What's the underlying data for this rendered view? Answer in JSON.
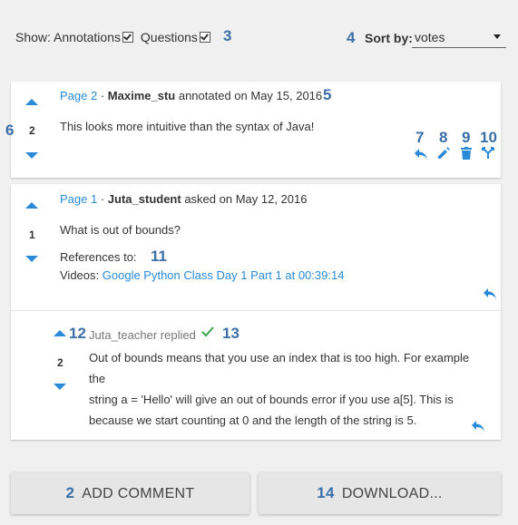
{
  "toolbar": {
    "show_label": "Show:",
    "annotations_label": "Annotations",
    "questions_label": "Questions",
    "sort_by_label": "Sort by:",
    "sort_value": "votes"
  },
  "annotations_markers": {
    "n2": "2",
    "n3": "3",
    "n4": "4",
    "n5": "5",
    "n6": "6",
    "n7": "7",
    "n8": "8",
    "n9": "9",
    "n10": "10",
    "n11": "11",
    "n12": "12",
    "n13": "13",
    "n14": "14"
  },
  "posts": [
    {
      "votes": "2",
      "page": "Page 2",
      "sep": "·",
      "author": "Maxime_stu",
      "action": "annotated on May 15, 2016",
      "text": "This looks more intuitive than the syntax of Java!"
    },
    {
      "votes": "1",
      "page": "Page 1",
      "sep": "·",
      "author": "Juta_student",
      "action": "asked on May 12, 2016",
      "text": "What is out of bounds?",
      "references_label": "References to:",
      "videos_label": "Videos:",
      "video_link": "Google Python Class Day 1 Part 1 at 00:39:14"
    }
  ],
  "reply": {
    "votes": "2",
    "author": "Juta_teacher",
    "action": "replied",
    "lines": [
      "Out of bounds means that you use an index that is too high. For example the",
      "string a = 'Hello' will give an out of bounds error if you use a[5]. This is",
      "because we start counting at 0 and the length of the string is 5."
    ]
  },
  "buttons": {
    "add_comment": "ADD COMMENT",
    "download": "DOWNLOAD..."
  },
  "colors": {
    "accent": "#2a8ad8",
    "annotation_marker": "#3a6fa8",
    "accepted": "#3aa34a",
    "background": "#f0f0f0"
  },
  "icons": [
    "reply-icon",
    "edit-icon",
    "delete-icon",
    "merge-icon",
    "check-icon"
  ]
}
